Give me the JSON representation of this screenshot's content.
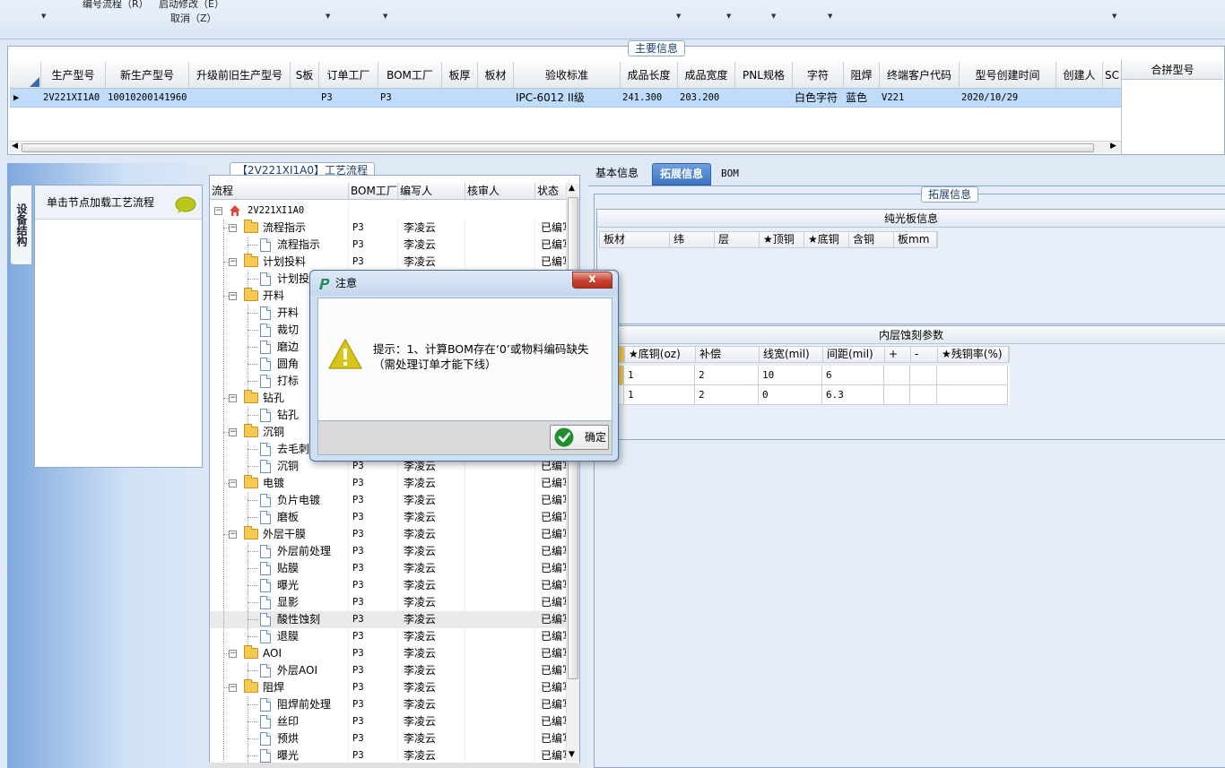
{
  "toolbar": {
    "items": [
      "编号流程（R）",
      "启动修改（E）",
      "取消（Z）"
    ]
  },
  "main_panel": {
    "title": "主要信息",
    "columns": [
      "生产型号",
      "新生产型号",
      "升级前旧生产型号",
      "S板",
      "订单工厂",
      "BOM工厂",
      "板厚",
      "板材",
      "验收标准",
      "成品长度",
      "成品宽度",
      "PNL规格",
      "字符",
      "阻焊",
      "终端客户代码",
      "型号创建时间",
      "创建人",
      "SC"
    ],
    "row": {
      "model": "2V221XI1A0",
      "new_model": "10010200141960",
      "order_factory": "P3",
      "bom_factory": "P3",
      "standard": "IPC-6012 II级",
      "length": "241.300",
      "width": "203.200",
      "legend": "白色字符",
      "solder_mask": "蓝色",
      "customer_code": "V221",
      "created": "2020/10/29"
    },
    "merge_header": "合拼型号"
  },
  "left_panel": {
    "vertical_tab": "设备结构",
    "hint": "单击节点加载工艺流程"
  },
  "tree": {
    "title": "【2V221XI1A0】工艺流程",
    "columns": [
      "流程",
      "BOM工厂",
      "编写人",
      "核审人",
      "状态"
    ],
    "root": "2V221XI1A0",
    "plant": "P3",
    "writer": "李凌云",
    "status": "已编写",
    "rows": [
      {
        "label": "流程指示",
        "level": 1
      },
      {
        "label": "流程指示",
        "level": 2
      },
      {
        "label": "计划投料",
        "level": 1
      },
      {
        "label": "计划投料",
        "level": 2
      },
      {
        "label": "开料",
        "level": 1
      },
      {
        "label": "开料",
        "level": 2
      },
      {
        "label": "裁切",
        "level": 2
      },
      {
        "label": "磨边",
        "level": 2
      },
      {
        "label": "圆角",
        "level": 2
      },
      {
        "label": "打标",
        "level": 2
      },
      {
        "label": "钻孔",
        "level": 1
      },
      {
        "label": "钻孔",
        "level": 2
      },
      {
        "label": "沉铜",
        "level": 1
      },
      {
        "label": "去毛刺",
        "level": 2
      },
      {
        "label": "沉铜",
        "level": 2
      },
      {
        "label": "电镀",
        "level": 1
      },
      {
        "label": "负片电镀",
        "level": 2
      },
      {
        "label": "磨板",
        "level": 2
      },
      {
        "label": "外层干膜",
        "level": 1
      },
      {
        "label": "外层前处理",
        "level": 2
      },
      {
        "label": "贴膜",
        "level": 2
      },
      {
        "label": "曝光",
        "level": 2
      },
      {
        "label": "显影",
        "level": 2
      },
      {
        "label": "酸性蚀刻",
        "level": 2
      },
      {
        "label": "退膜",
        "level": 2
      },
      {
        "label": "AOI",
        "level": 1
      },
      {
        "label": "外层AOI",
        "level": 2
      },
      {
        "label": "阻焊",
        "level": 1
      },
      {
        "label": "阻焊前处理",
        "level": 2
      },
      {
        "label": "丝印",
        "level": 2
      },
      {
        "label": "预烘",
        "level": 2
      },
      {
        "label": "曝光",
        "level": 2
      }
    ]
  },
  "right_tabs": {
    "tabs": [
      "基本信息",
      "拓展信息",
      "BOM"
    ],
    "active": "拓展信息"
  },
  "ext_info": {
    "title": "拓展信息",
    "plain_board": {
      "title": "纯光板信息",
      "columns": [
        "板材",
        "纬",
        "层",
        "★顶铜",
        "★底铜",
        "含铜",
        "板mm"
      ]
    },
    "inner_etch": {
      "title": "内层蚀刻参数",
      "columns": [
        "★底铜(oz)",
        "补偿",
        "线宽(mil)",
        "间距(mil)",
        "+",
        "-",
        "★残铜率(%)"
      ],
      "rows": [
        [
          "1",
          "2",
          "10",
          "6",
          "",
          "",
          ""
        ],
        [
          "1",
          "2",
          "0",
          "6.3",
          "",
          "",
          ""
        ]
      ]
    }
  },
  "dialog": {
    "title": "注意",
    "close": "x",
    "message": "提示：1、计算BOM存在‘0’或物料编码缺失（需处理订单才能下线）",
    "ok": "确定"
  },
  "colors": {
    "selection": "#bfdcfa",
    "active_tab": "#3c73bf",
    "folder": "#f6ca52",
    "warning": "#d9c51a",
    "ok_check": "#1f8f2e"
  }
}
